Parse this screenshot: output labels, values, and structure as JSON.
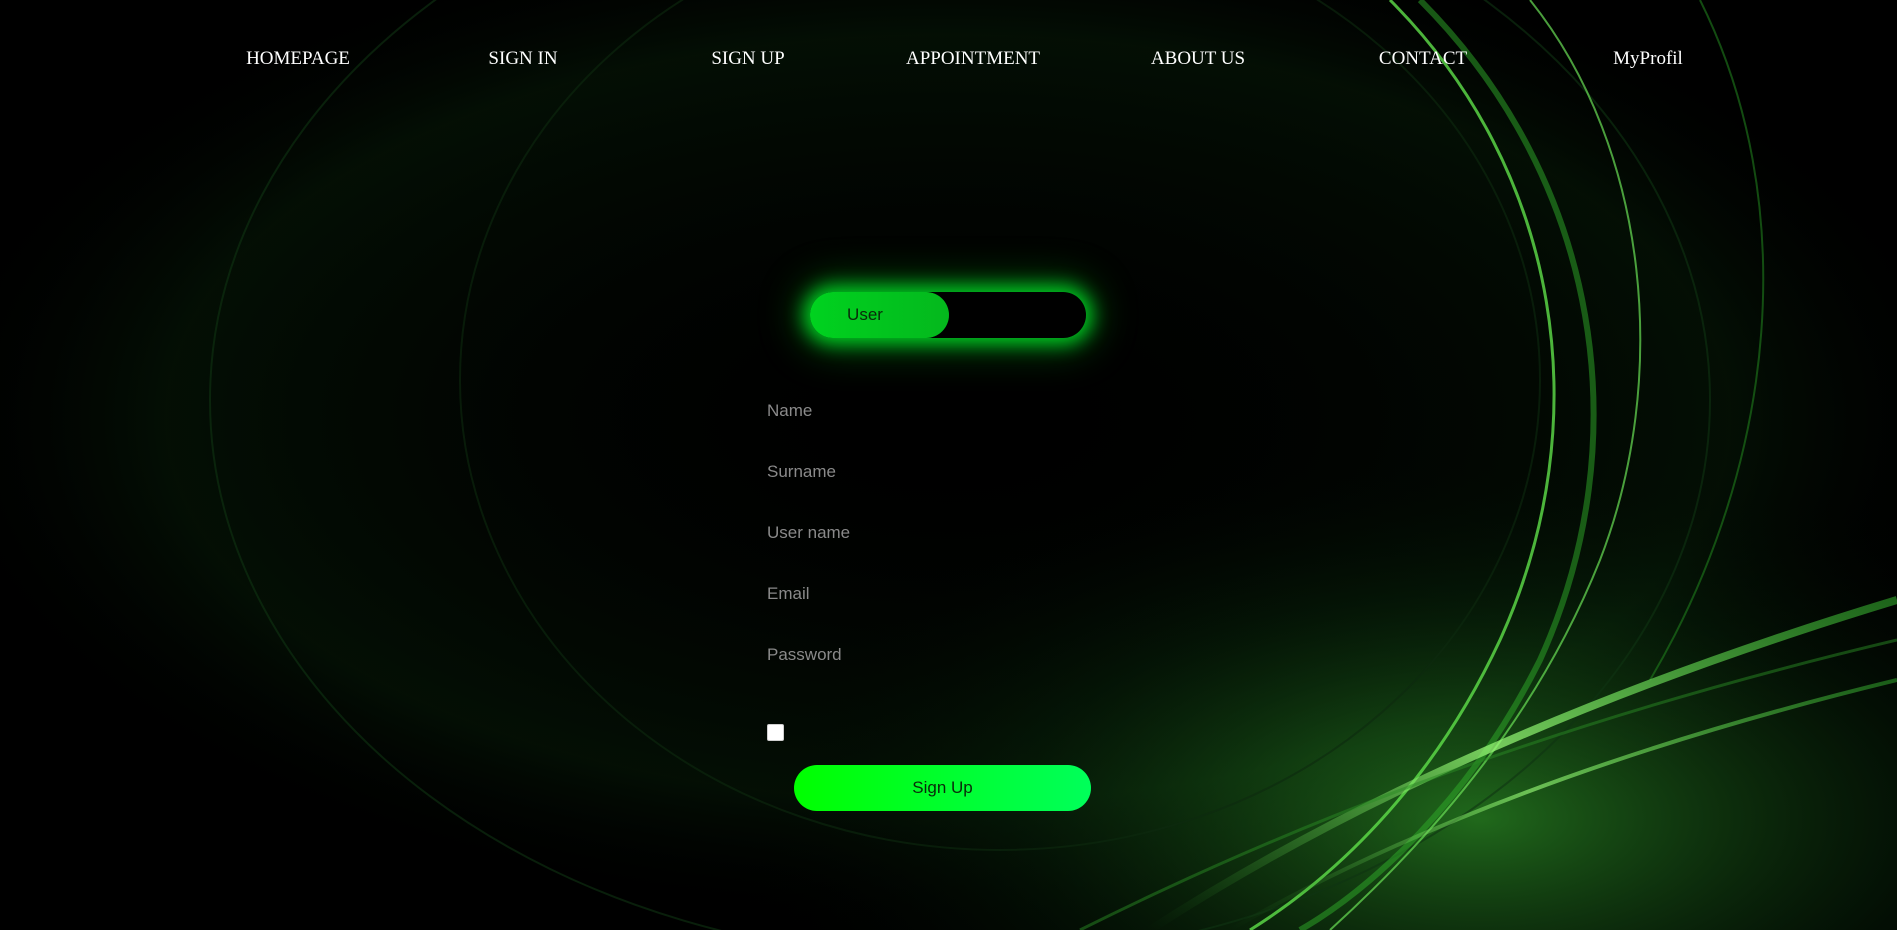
{
  "nav": {
    "items": [
      {
        "label": "HOMEPAGE"
      },
      {
        "label": "SIGN IN"
      },
      {
        "label": "SIGN UP"
      },
      {
        "label": "APPOINTMENT"
      },
      {
        "label": "ABOUT US"
      },
      {
        "label": "CONTACT"
      },
      {
        "label": "MyProfil"
      }
    ]
  },
  "role_toggle": {
    "active_label": "User",
    "active_color": "#00d21f"
  },
  "form": {
    "fields": [
      {
        "placeholder": "Name",
        "value": ""
      },
      {
        "placeholder": "Surname",
        "value": ""
      },
      {
        "placeholder": "User name",
        "value": ""
      },
      {
        "placeholder": "Email",
        "value": ""
      },
      {
        "placeholder": "Password",
        "value": ""
      }
    ],
    "checkbox_checked": false,
    "submit_label": "Sign Up",
    "submit_color": "#00ff2a"
  },
  "theme": {
    "background": "#000000",
    "accent": "#3fd14a"
  }
}
